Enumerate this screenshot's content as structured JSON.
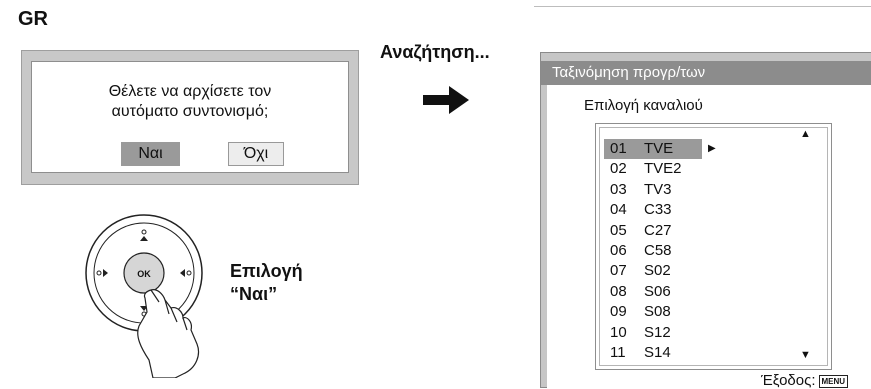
{
  "language_code": "GR",
  "dialog": {
    "question_line1": "Θέλετε να αρχίσετε τον",
    "question_line2": "αυτόματο συντονισμό;",
    "yes_label": "Ναι",
    "no_label": "Όχι"
  },
  "searching_label": "Αναζήτηση...",
  "remote": {
    "ok_label": "OK",
    "instruction_line1": "Επιλογή",
    "instruction_line2": "“Ναι”"
  },
  "menu": {
    "title": "Ταξινόμηση προγρ/των",
    "subtitle": "Επιλογή  καναλιού",
    "selected_index": 0,
    "channels": [
      {
        "num": "01",
        "name": "TVE"
      },
      {
        "num": "02",
        "name": "TVE2"
      },
      {
        "num": "03",
        "name": "TV3"
      },
      {
        "num": "04",
        "name": "C33"
      },
      {
        "num": "05",
        "name": "C27"
      },
      {
        "num": "06",
        "name": "C58"
      },
      {
        "num": "07",
        "name": "S02"
      },
      {
        "num": "08",
        "name": "S06"
      },
      {
        "num": "09",
        "name": "S08"
      },
      {
        "num": "10",
        "name": "S12"
      },
      {
        "num": "11",
        "name": "S14"
      }
    ],
    "exit_label": "Έξοδος:",
    "menu_key_label": "MENU"
  }
}
